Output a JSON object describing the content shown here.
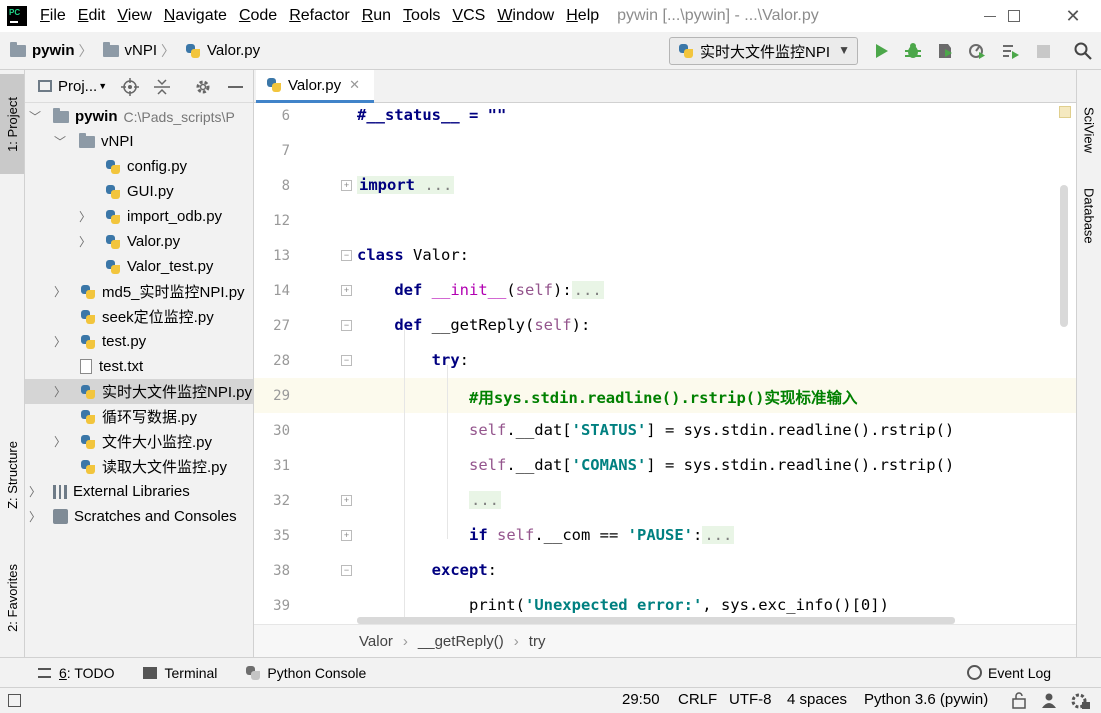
{
  "menubar": {
    "logo": "PC",
    "items": [
      "File",
      "Edit",
      "View",
      "Navigate",
      "Code",
      "Refactor",
      "Run",
      "Tools",
      "VCS",
      "Window",
      "Help"
    ],
    "underline": [
      "F",
      "E",
      "V",
      "N",
      "C",
      "R",
      "R",
      "T",
      "V",
      "W",
      "H"
    ],
    "window_title": "pywin [...\\pywin] - ...\\Valor.py"
  },
  "navbar": {
    "crumbs": [
      "pywin",
      "vNPI",
      "Valor.py"
    ],
    "run_config": "实时大文件监控NPI"
  },
  "left_strip": {
    "project": "1: Project",
    "structure": "Z: Structure",
    "favorites": "2: Favorites"
  },
  "right_strip": {
    "sciview": "SciView",
    "database": "Database"
  },
  "project_panel": {
    "title": "Proj...",
    "root_name": "pywin",
    "root_path": "C:\\Pads_scripts\\P",
    "items": [
      {
        "label": "vNPI"
      },
      {
        "label": "config.py"
      },
      {
        "label": "GUI.py"
      },
      {
        "label": "import_odb.py"
      },
      {
        "label": "Valor.py"
      },
      {
        "label": "Valor_test.py"
      },
      {
        "label": "md5_实时监控NPI.py"
      },
      {
        "label": "seek定位监控.py"
      },
      {
        "label": "test.py"
      },
      {
        "label": "test.txt"
      },
      {
        "label": "实时大文件监控NPI.py"
      },
      {
        "label": "循环写数据.py"
      },
      {
        "label": "文件大小监控.py"
      },
      {
        "label": "读取大文件监控.py"
      },
      {
        "label": "External Libraries"
      },
      {
        "label": "Scratches and Consoles"
      }
    ]
  },
  "editor": {
    "tab": "Valor.py",
    "line_numbers": [
      "6",
      "7",
      "8",
      "12",
      "13",
      "14",
      "27",
      "28",
      "29",
      "30",
      "31",
      "32",
      "35",
      "38",
      "39"
    ],
    "code": {
      "l6": "#__status__ = \"\"",
      "l8_kw": "import",
      "l8_fold": "...",
      "l13_kw": "class",
      "l13_name": " Valor:",
      "l14_kw": "def",
      "l14_name": " __init__",
      "l14_open": "(",
      "l14_self": "self",
      "l14_close": "):",
      "l14_fold": "...",
      "l27_kw": "def",
      "l27_name": " __getReply(",
      "l27_self": "self",
      "l27_close": "):",
      "l28_kw": "try",
      "l28_colon": ":",
      "l29": "#用sys.stdin.readline().rstrip()实现标准输入",
      "l30_self": "self",
      "l30_a": ".__dat[",
      "l30_str": "'STATUS'",
      "l30_b": "] = sys.stdin.readline().rstrip()",
      "l31_self": "self",
      "l31_a": ".__dat[",
      "l31_str": "'COMANS'",
      "l31_b": "] = sys.stdin.readline().rstrip()",
      "l32_fold": "...",
      "l35_kw": "if",
      "l35_self": "self",
      "l35_a": ".__com == ",
      "l35_str": "'PAUSE'",
      "l35_colon": ":",
      "l35_fold": "...",
      "l38_kw": "except",
      "l38_colon": ":",
      "l39_a": "print(",
      "l39_str": "'Unexpected error:'",
      "l39_b": ", sys.exc_info()[0])"
    },
    "breadcrumb": [
      "Valor",
      "__getReply()",
      "try"
    ]
  },
  "bottom_tabs": {
    "todo_num": "6",
    "todo": ": TODO",
    "terminal": "Terminal",
    "console": "Python Console",
    "event_log": "Event Log"
  },
  "statusbar": {
    "position": "29:50",
    "line_sep": "CRLF",
    "encoding": "UTF-8",
    "indent": "4 spaces",
    "interpreter": "Python 3.6 (pywin)"
  }
}
